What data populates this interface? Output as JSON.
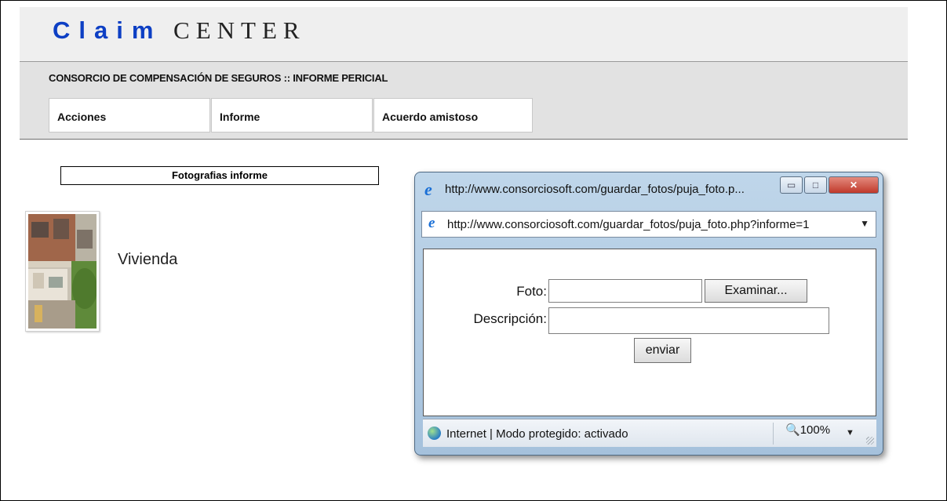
{
  "app": {
    "logo_claim": "Claim",
    "logo_center": "CENTER",
    "subtitle": "CONSORCIO DE COMPENSACIÓN DE SEGUROS :: INFORME PERICIAL"
  },
  "nav": {
    "items": [
      {
        "label": "Acciones"
      },
      {
        "label": "Informe"
      },
      {
        "label": "Acuerdo amistoso"
      }
    ]
  },
  "photos": {
    "section_title": "Fotografias informe",
    "items": [
      {
        "caption": "Vivienda"
      }
    ]
  },
  "popup": {
    "title": "http://www.consorciosoft.com/guardar_fotos/puja_foto.p...",
    "address": "http://www.consorciosoft.com/guardar_fotos/puja_foto.php?informe=1",
    "form": {
      "foto_label": "Foto:",
      "foto_value": "",
      "browse_label": "Examinar...",
      "desc_label": "Descripción:",
      "desc_value": "",
      "submit_label": "enviar"
    },
    "status_text": "Internet | Modo protegido: activado",
    "zoom": "100%"
  },
  "colors": {
    "logo_blue": "#0d3fc4",
    "header_bg": "#efefef",
    "bar_bg": "#e2e2e2"
  }
}
